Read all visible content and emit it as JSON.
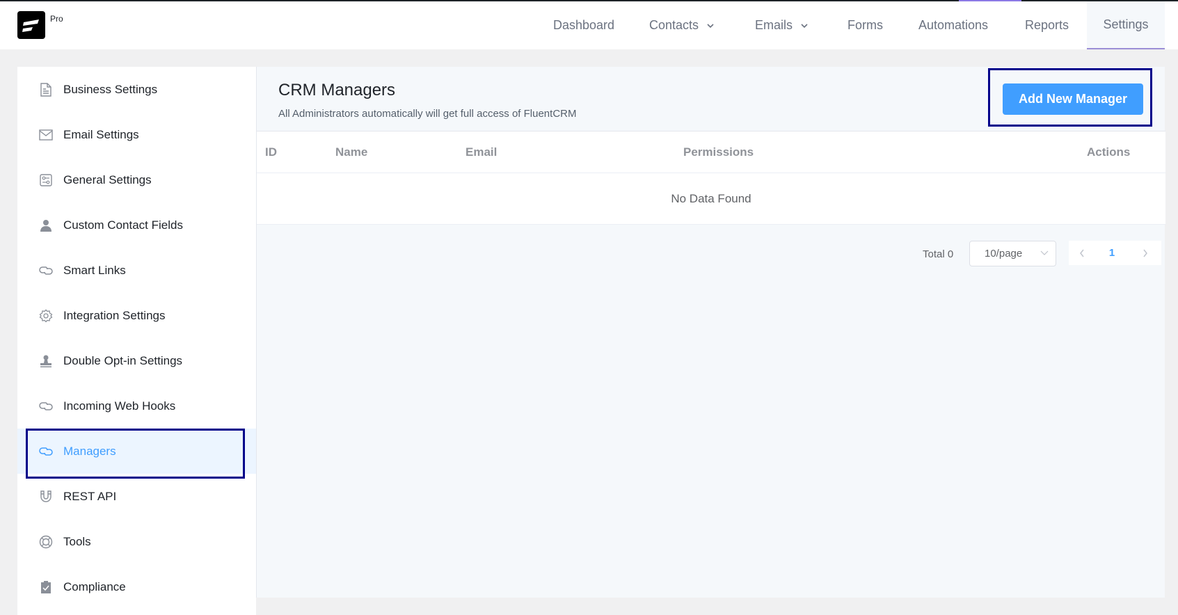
{
  "app": {
    "badge": "Pro",
    "logo_icon": "fluentcrm-logo-icon"
  },
  "nav": {
    "items": [
      {
        "label": "Dashboard",
        "has_dropdown": false,
        "active": false
      },
      {
        "label": "Contacts",
        "has_dropdown": true,
        "active": false
      },
      {
        "label": "Emails",
        "has_dropdown": true,
        "active": false
      },
      {
        "label": "Forms",
        "has_dropdown": false,
        "active": false
      },
      {
        "label": "Automations",
        "has_dropdown": false,
        "active": false
      },
      {
        "label": "Reports",
        "has_dropdown": false,
        "active": false
      },
      {
        "label": "Settings",
        "has_dropdown": false,
        "active": true
      }
    ]
  },
  "sidebar": {
    "items": [
      {
        "label": "Business Settings",
        "icon": "document-icon"
      },
      {
        "label": "Email Settings",
        "icon": "envelope-icon"
      },
      {
        "label": "General Settings",
        "icon": "settings-sliders-icon"
      },
      {
        "label": "Custom Contact Fields",
        "icon": "user-icon"
      },
      {
        "label": "Smart Links",
        "icon": "link-icon"
      },
      {
        "label": "Integration Settings",
        "icon": "gear-icon"
      },
      {
        "label": "Double Opt-in Settings",
        "icon": "stamp-icon"
      },
      {
        "label": "Incoming Web Hooks",
        "icon": "link-icon"
      },
      {
        "label": "Managers",
        "icon": "link-icon",
        "active": true
      },
      {
        "label": "REST API",
        "icon": "magnet-icon"
      },
      {
        "label": "Tools",
        "icon": "lifebuoy-icon"
      },
      {
        "label": "Compliance",
        "icon": "clipboard-check-icon"
      }
    ]
  },
  "main": {
    "title": "CRM Managers",
    "subtitle": "All Administrators automatically will get full access of FluentCRM",
    "add_button": "Add New Manager",
    "table": {
      "columns": [
        "ID",
        "Name",
        "Email",
        "Permissions",
        "Actions"
      ],
      "rows": [],
      "empty_text": "No Data Found"
    },
    "pagination": {
      "total_label": "Total 0",
      "page_size": "10/page",
      "current_page": "1",
      "prev_icon": "chevron-left-icon",
      "next_icon": "chevron-right-icon"
    }
  },
  "colors": {
    "primary": "#409eff",
    "highlight_box": "#00008b",
    "active_tab_underline": "#9b8fd6"
  }
}
